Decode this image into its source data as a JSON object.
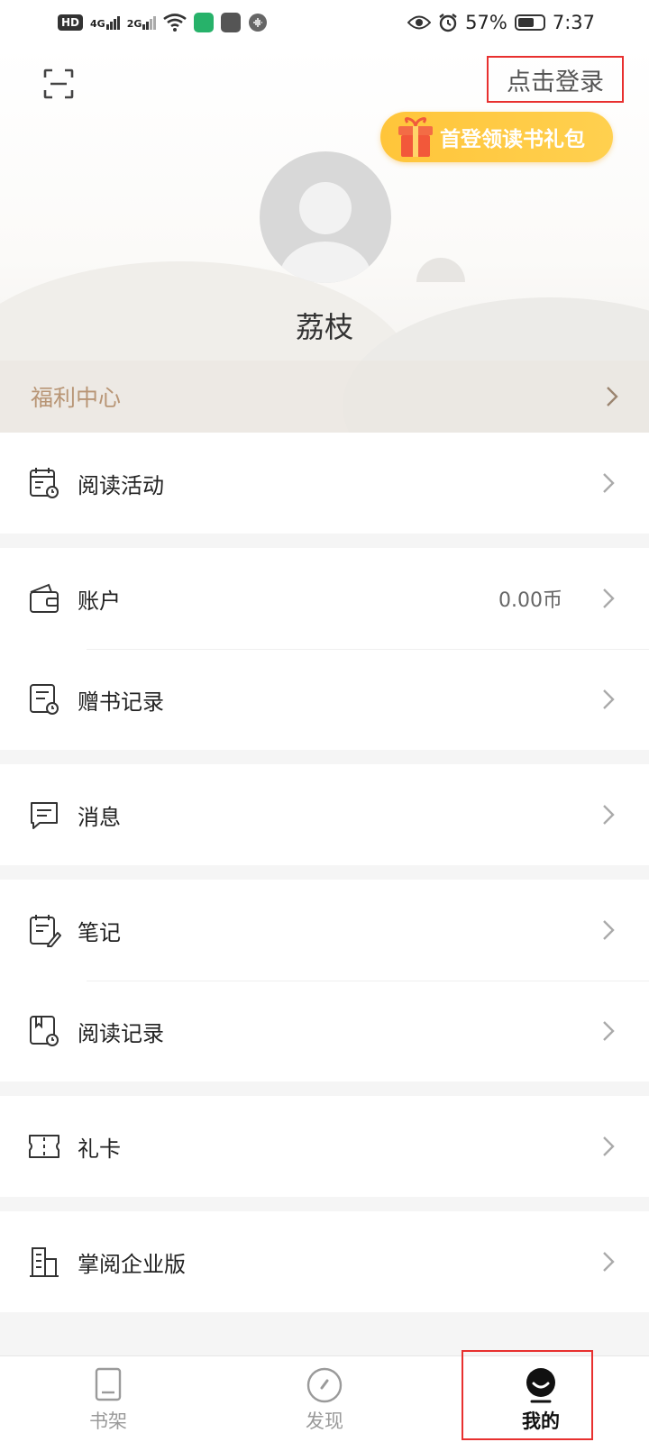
{
  "status_bar": {
    "hd": "HD",
    "net1": "4G",
    "net2": "2G",
    "battery_pct": "57%",
    "time": "7:37"
  },
  "header": {
    "login_label": "点击登录",
    "gift_label": "首登领读书礼包",
    "username": "荔枝",
    "welfare_label": "福利中心"
  },
  "menu": {
    "reading_activity": "阅读活动",
    "account": "账户",
    "account_value": "0.00币",
    "gift_record": "赠书记录",
    "messages": "消息",
    "notes": "笔记",
    "reading_record": "阅读记录",
    "gift_card": "礼卡",
    "enterprise": "掌阅企业版"
  },
  "bottom_nav": {
    "bookshelf": "书架",
    "discover": "发现",
    "mine": "我的"
  },
  "colors": {
    "accent_red": "#e8302f",
    "gift_yellow": "#ffc53a",
    "welfare_text": "#b89575"
  }
}
